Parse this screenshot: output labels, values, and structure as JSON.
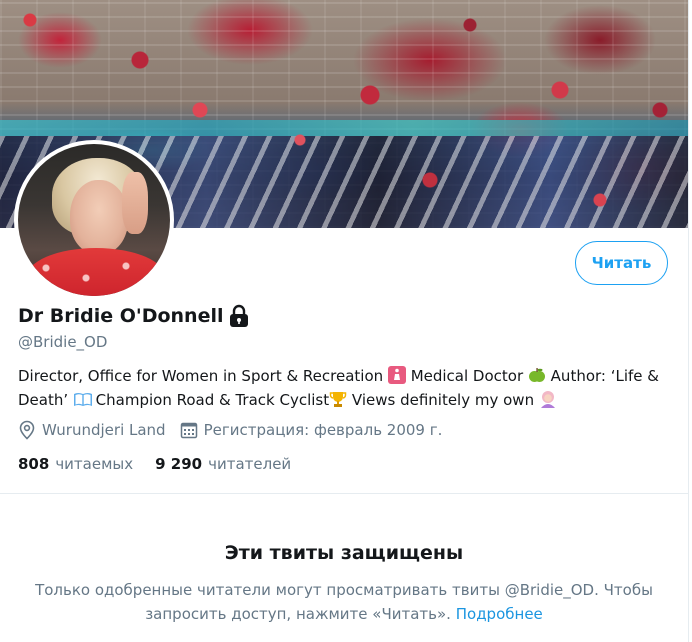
{
  "profile": {
    "name": "Dr Bridie O'Donnell",
    "handle": "@Bridie_OD",
    "bio": {
      "part1": "Director, Office for Women in Sport & Recreation ",
      "part2": " Medical Doctor ",
      "part3": " Author: ‘Life & Death’ ",
      "part4": " Champion Road & Track Cyclist",
      "part5": " Views definitely my own "
    },
    "location": "Wurundjeri Land",
    "joined": "Регистрация: февраль 2009 г.",
    "following_count": "808",
    "following_label": "читаемых",
    "followers_count": "9 290",
    "followers_label": "читателей"
  },
  "actions": {
    "follow_label": "Читать"
  },
  "protected": {
    "title": "Эти твиты защищены",
    "text": "Только одобренные читатели могут просматривать твиты @Bridie_OD. Чтобы запросить доступ, нажмите «Читать».",
    "learn_more": "Подробнее"
  },
  "colors": {
    "accent": "#1da1f2",
    "secondary_text": "#657786",
    "primary_text": "#14171a"
  },
  "icons": [
    "lock-icon",
    "restroom-emoji",
    "green-apple-emoji",
    "book-emoji",
    "trophy-emoji",
    "woman-emoji",
    "location-icon",
    "calendar-icon"
  ]
}
